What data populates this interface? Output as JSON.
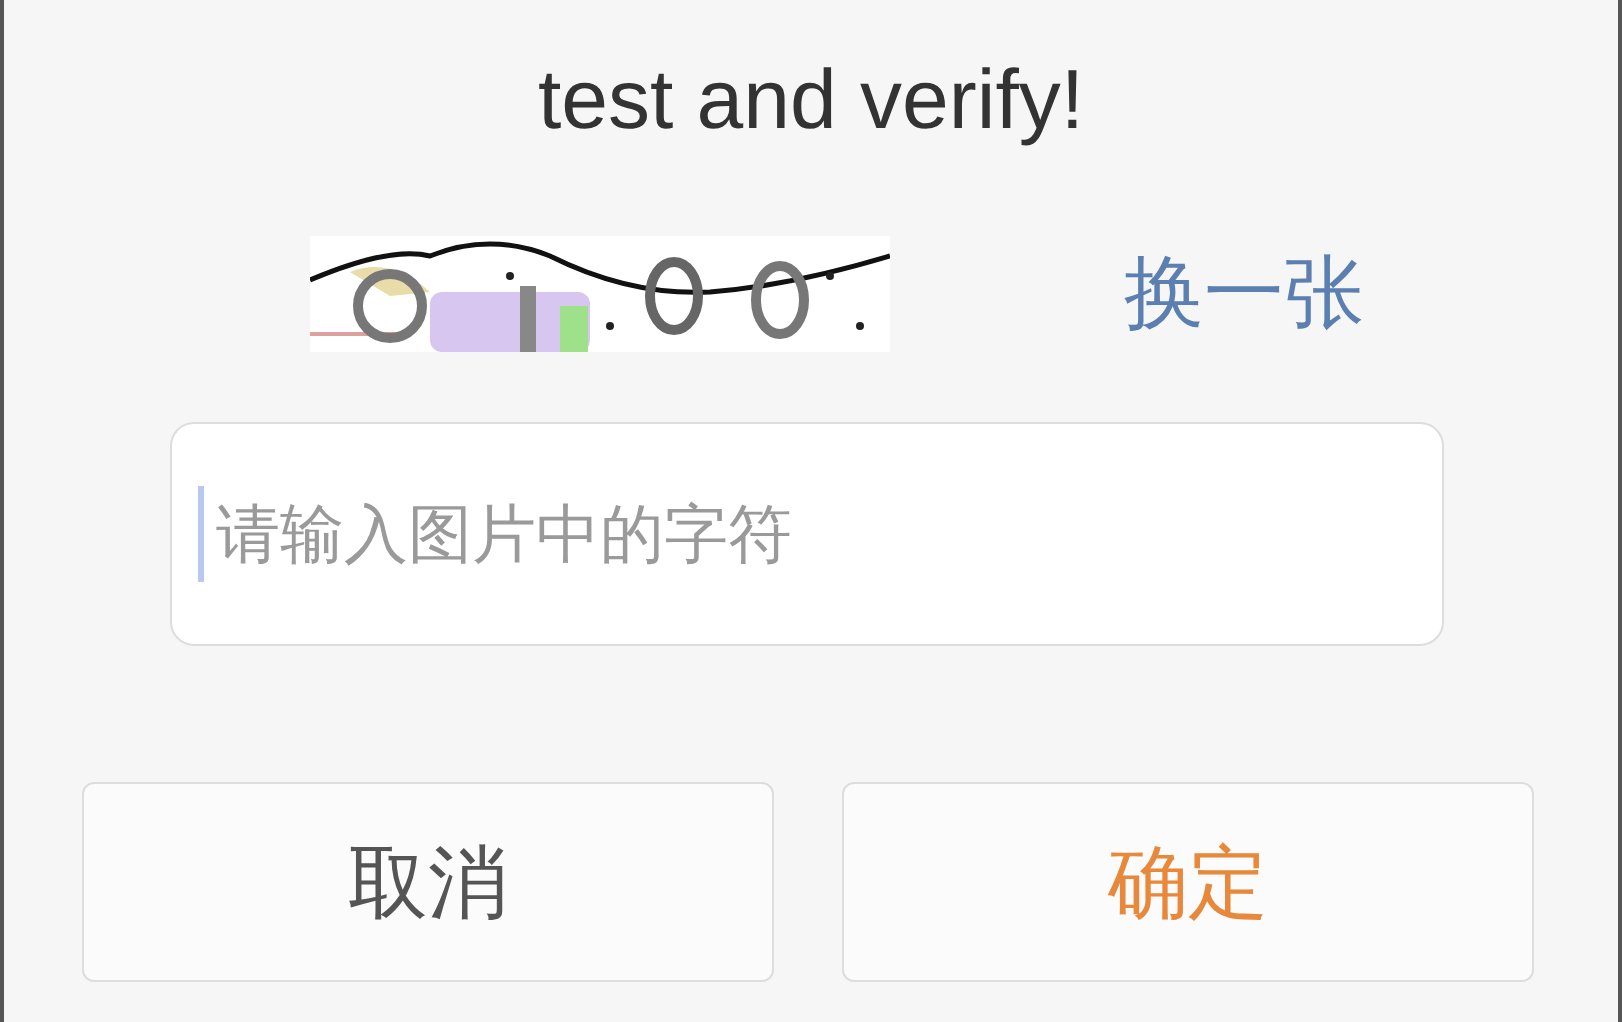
{
  "dialog": {
    "title": "test and verify!",
    "refresh_link": "换一张",
    "input": {
      "placeholder": "请输入图片中的字符"
    },
    "buttons": [
      {
        "label": "取消",
        "kind": "cancel"
      },
      {
        "label": "确定",
        "kind": "confirm"
      }
    ]
  }
}
